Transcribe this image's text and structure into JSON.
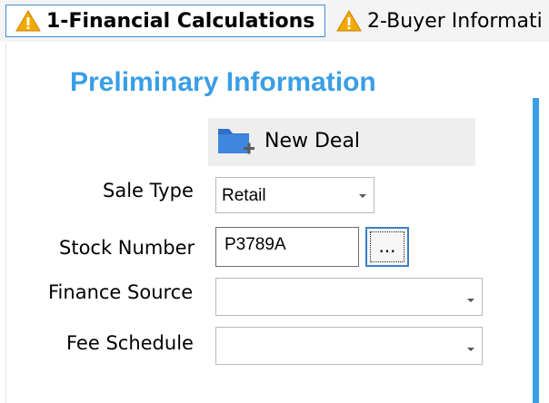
{
  "tabs": [
    {
      "label": "1-Financial Calculations",
      "icon": "warning-icon"
    },
    {
      "label": "2-Buyer Informati",
      "icon": "warning-icon"
    }
  ],
  "section": {
    "title": "Preliminary Information"
  },
  "new_deal": {
    "label": "New Deal",
    "icon": "new-folder-icon"
  },
  "fields": {
    "sale_type": {
      "label": "Sale Type",
      "value": "Retail"
    },
    "stock_number": {
      "label": "Stock Number",
      "value": "P3789A",
      "button_label": "..."
    },
    "finance_source": {
      "label": "Finance Source",
      "value": ""
    },
    "fee_schedule": {
      "label": "Fee Schedule",
      "value": ""
    }
  },
  "colors": {
    "accent": "#3a9ee6",
    "tab_border": "#3d8fd6",
    "warning": "#f2a900"
  }
}
